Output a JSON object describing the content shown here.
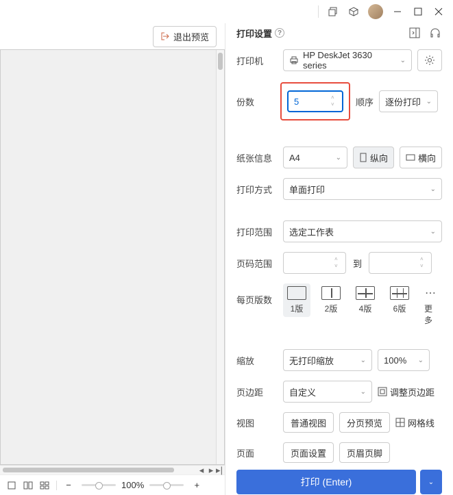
{
  "titlebar": {},
  "preview": {
    "exit_label": "退出预览",
    "zoom_pct": "100%"
  },
  "panel": {
    "title": "打印设置",
    "printer": {
      "label": "打印机",
      "value": "HP DeskJet 3630 series"
    },
    "copies": {
      "label": "份数",
      "value": "5"
    },
    "order": {
      "label": "顺序",
      "value": "逐份打印"
    },
    "paper": {
      "label": "纸张信息",
      "value": "A4",
      "portrait": "纵向",
      "landscape": "横向"
    },
    "duplex": {
      "label": "打印方式",
      "value": "单面打印"
    },
    "range": {
      "label": "打印范围",
      "value": "选定工作表"
    },
    "pages": {
      "label": "页码范围",
      "from": "",
      "to_label": "到",
      "to": ""
    },
    "layout": {
      "label": "每页版数",
      "opts": [
        "1版",
        "2版",
        "4版",
        "6版"
      ],
      "more": "更多"
    },
    "scale": {
      "label": "缩放",
      "value": "无打印缩放",
      "pct": "100%"
    },
    "margin": {
      "label": "页边距",
      "value": "自定义",
      "adjust": "调整页边距"
    },
    "view": {
      "label": "视图",
      "normal": "普通视图",
      "paged": "分页预览",
      "grid": "网格线"
    },
    "page": {
      "label": "页面",
      "setup": "页面设置",
      "header": "页眉页脚"
    },
    "print_btn": "打印 (Enter)"
  }
}
